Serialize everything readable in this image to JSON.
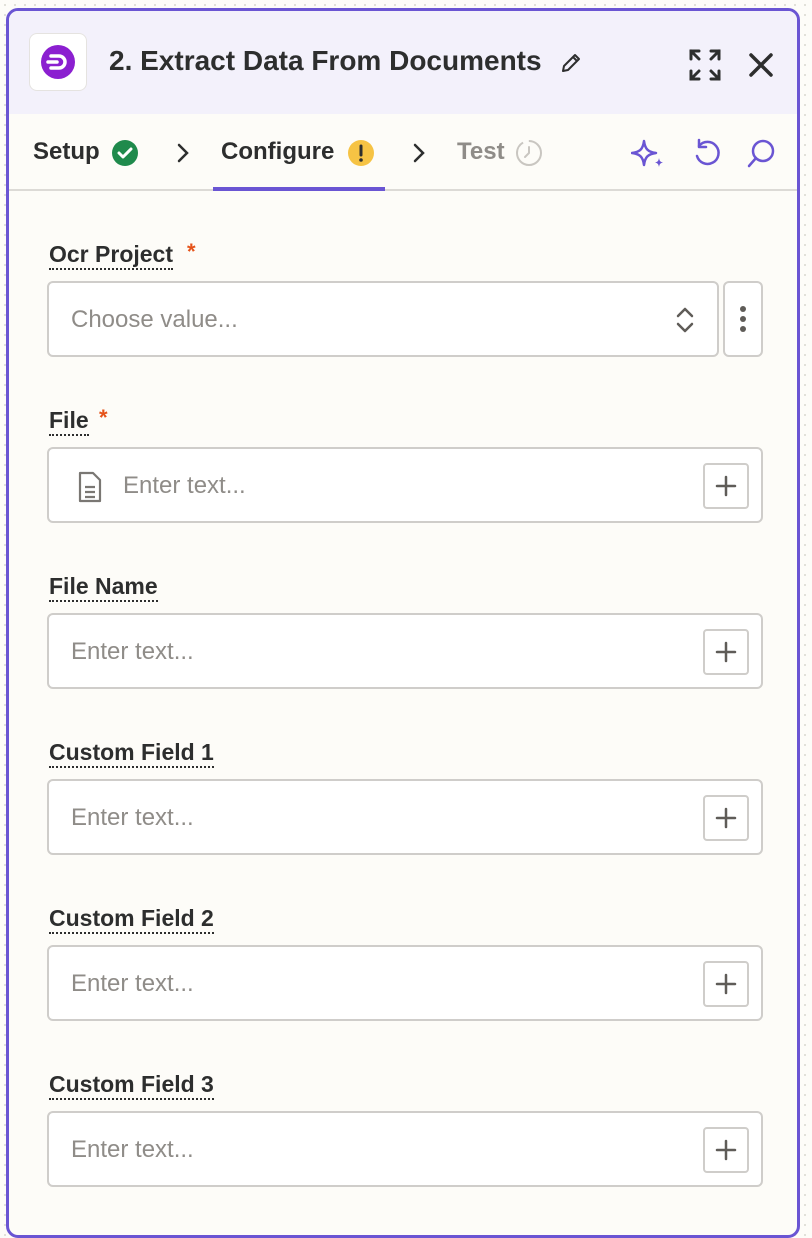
{
  "header": {
    "title": "2. Extract Data From Documents",
    "app_icon": "documents-app-logo",
    "icons": [
      "pencil-icon",
      "expand-icon",
      "close-icon"
    ]
  },
  "tabs": [
    {
      "label": "Setup",
      "status": "complete"
    },
    {
      "label": "Configure",
      "status": "warning",
      "active": true
    },
    {
      "label": "Test",
      "status": "pending"
    }
  ],
  "toolbar_icons": [
    "sparkle-icon",
    "undo-icon",
    "search-icon"
  ],
  "colors": {
    "accent": "#6a55d3",
    "success": "#1f8a4c",
    "warning": "#f6c344",
    "required": "#e5531a",
    "header_bg": "#f3f1fb"
  },
  "fields": [
    {
      "label": "Ocr Project",
      "required": "*",
      "placeholder": "Choose value...",
      "type": "select"
    },
    {
      "label": "File",
      "required": "*",
      "placeholder": "Enter text...",
      "type": "file"
    },
    {
      "label": "File Name",
      "placeholder": "Enter text...",
      "type": "text"
    },
    {
      "label": "Custom Field 1",
      "placeholder": "Enter text...",
      "type": "text"
    },
    {
      "label": "Custom Field 2",
      "placeholder": "Enter text...",
      "type": "text"
    },
    {
      "label": "Custom Field 3",
      "placeholder": "Enter text...",
      "type": "text"
    }
  ]
}
